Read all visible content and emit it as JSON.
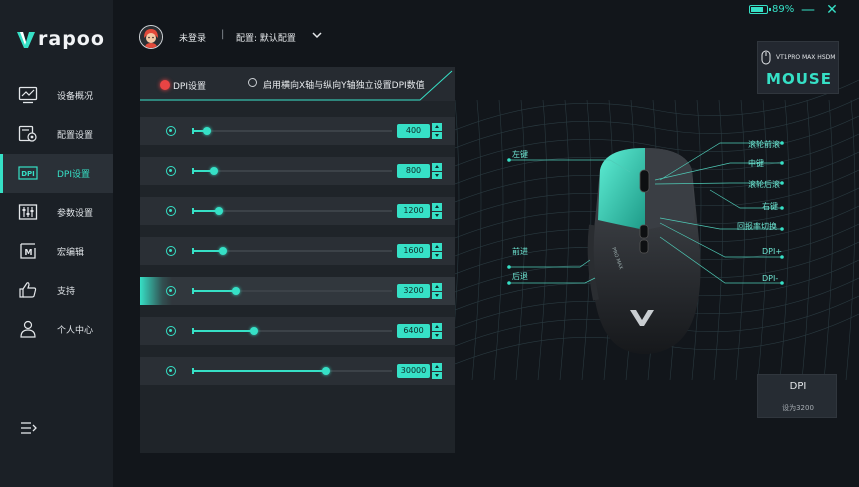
{
  "brand": {
    "logo_text": "rapoo"
  },
  "topbar": {
    "battery_percent": 89,
    "battery_label": "89%",
    "minimize_glyph": "—",
    "close_glyph": "✕"
  },
  "user": {
    "status": "未登录",
    "separator": "|",
    "config_label": "配置: 默认配置"
  },
  "sidebar": {
    "items": [
      {
        "label": "设备概况",
        "icon": "monitor-chart-icon"
      },
      {
        "label": "配置设置",
        "icon": "config-gear-icon"
      },
      {
        "label": "DPI设置",
        "icon": "dpi-icon",
        "icon_text": "DPI"
      },
      {
        "label": "参数设置",
        "icon": "sliders-icon"
      },
      {
        "label": "宏编辑",
        "icon": "macro-icon",
        "icon_text": "M"
      },
      {
        "label": "支持",
        "icon": "thumbs-up-icon"
      },
      {
        "label": "个人中心",
        "icon": "user-icon"
      }
    ],
    "active_index": 2
  },
  "dpi_panel": {
    "option1": "DPI设置",
    "option2": "启用横向X轴与纵向Y轴独立设置DPI数值",
    "max_dpi": 30000,
    "active_level": 4,
    "levels": [
      {
        "value": 400,
        "label": "400"
      },
      {
        "value": 800,
        "label": "800"
      },
      {
        "value": 1200,
        "label": "1200"
      },
      {
        "value": 1600,
        "label": "1600"
      },
      {
        "value": 3200,
        "label": "3200"
      },
      {
        "value": 6400,
        "label": "6400"
      },
      {
        "value": 30000,
        "label": "30000"
      }
    ]
  },
  "mouse_callouts": {
    "left": [
      "左键",
      "前进",
      "后退"
    ],
    "right": [
      "滚轮前滚",
      "中键",
      "滚轮后滚",
      "右键",
      "回报率切换",
      "DPI+",
      "DPI-"
    ]
  },
  "mouse_side_text": "PRO MAX",
  "device": {
    "model": "VT1PRO MAX HSDM",
    "name": "MOUSE"
  },
  "dpi_card": {
    "title": "DPI",
    "subtitle": "设为3200"
  },
  "colors": {
    "accent": "#36e0c6",
    "bg": "#12161b",
    "panel": "#1f2429",
    "red": "#e84444"
  }
}
